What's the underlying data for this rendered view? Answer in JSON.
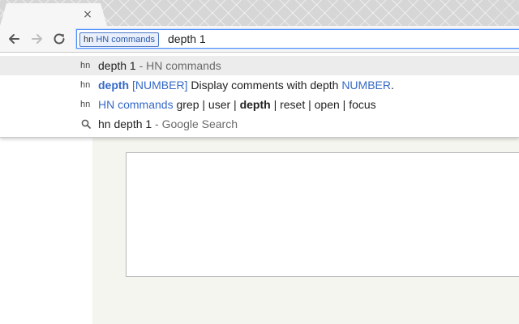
{
  "tab": {
    "close_glyph": "×"
  },
  "omnibox": {
    "keyword_prefix": "hn",
    "keyword_name": "HN commands",
    "text": "depth 1"
  },
  "suggestions": [
    {
      "icon": "hn",
      "main": "depth 1",
      "suffix": " - HN commands"
    },
    {
      "icon": "hn",
      "cmd": "depth",
      "arg": " [NUMBER]",
      "desc": " Display comments with depth ",
      "desc_arg": "NUMBER",
      "end": "."
    },
    {
      "icon": "hn",
      "name": "HN commands",
      "list_a": " grep | user | ",
      "list_bold": "depth",
      "list_b": " | reset | open | focus"
    },
    {
      "icon": "search-icon",
      "main": "hn depth 1",
      "suffix": " - Google Search"
    }
  ],
  "colors": {
    "accent": "#3569c7",
    "focus_ring": "#4d90fe",
    "page_bg": "#f5f5ef"
  }
}
